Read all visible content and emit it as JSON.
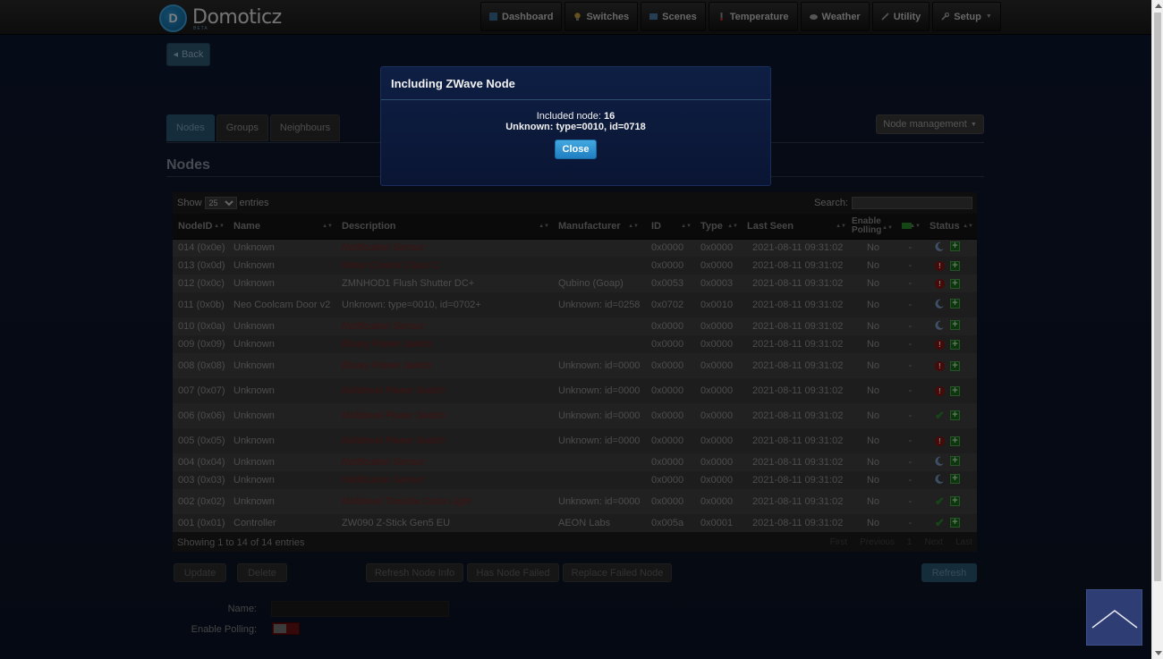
{
  "brand": {
    "name": "Domoticz",
    "sub": "BETA",
    "logo_letter": "D"
  },
  "nav": [
    {
      "label": "Dashboard",
      "icon": "dashboard-icon"
    },
    {
      "label": "Switches",
      "icon": "bulb-icon"
    },
    {
      "label": "Scenes",
      "icon": "scenes-icon"
    },
    {
      "label": "Temperature",
      "icon": "thermometer-icon"
    },
    {
      "label": "Weather",
      "icon": "cloud-icon"
    },
    {
      "label": "Utility",
      "icon": "utility-icon"
    },
    {
      "label": "Setup",
      "icon": "wrench-icon"
    }
  ],
  "back_label": "Back",
  "tabs": [
    {
      "label": "Nodes",
      "active": true
    },
    {
      "label": "Groups",
      "active": false
    },
    {
      "label": "Neighbours",
      "active": false
    }
  ],
  "node_management": "Node management",
  "section_title": "Nodes",
  "table": {
    "show_prefix": "Show",
    "show_value": "25",
    "show_suffix": "entries",
    "search_label": "Search:",
    "columns": [
      "NodeID",
      "Name",
      "Description",
      "Manufacturer",
      "ID",
      "Type",
      "Last Seen",
      "Enable Polling",
      "",
      "Status"
    ],
    "rows": [
      {
        "nodeid": "014 (0x0e)",
        "name": "Unknown",
        "desc": "Notification Sensor",
        "desc_red": true,
        "mfr": "",
        "id": "0x0000",
        "type": "0x0000",
        "seen": "2021-08-11 09:31:02",
        "poll": "No",
        "dash": "-",
        "status": "sleep"
      },
      {
        "nodeid": "013 (0x0d)",
        "name": "Unknown",
        "desc": "Motor Control Class C",
        "desc_red": true,
        "mfr": "",
        "id": "0x0000",
        "type": "0x0000",
        "seen": "2021-08-11 09:31:02",
        "poll": "No",
        "dash": "-",
        "status": "dead"
      },
      {
        "nodeid": "012 (0x0c)",
        "name": "Unknown",
        "desc": "ZMNHOD1 Flush Shutter DC+",
        "desc_red": false,
        "mfr": "Qubino (Goap)",
        "id": "0x0053",
        "type": "0x0003",
        "seen": "2021-08-11 09:31:02",
        "poll": "No",
        "dash": "-",
        "status": "dead"
      },
      {
        "nodeid": "011 (0x0b)",
        "name": "Neo Coolcam Door v2",
        "desc": "Unknown: type=0010, id=0702+",
        "desc_red": false,
        "mfr": "Unknown: id=0258",
        "id": "0x0702",
        "type": "0x0010",
        "seen": "2021-08-11 09:31:02",
        "poll": "No",
        "dash": "-",
        "status": "sleep"
      },
      {
        "nodeid": "010 (0x0a)",
        "name": "Unknown",
        "desc": "Notification Sensor",
        "desc_red": true,
        "mfr": "",
        "id": "0x0000",
        "type": "0x0000",
        "seen": "2021-08-11 09:31:02",
        "poll": "No",
        "dash": "-",
        "status": "sleep"
      },
      {
        "nodeid": "009 (0x09)",
        "name": "Unknown",
        "desc": "Binary Power Switch",
        "desc_red": true,
        "mfr": "",
        "id": "0x0000",
        "type": "0x0000",
        "seen": "2021-08-11 09:31:02",
        "poll": "No",
        "dash": "-",
        "status": "dead"
      },
      {
        "nodeid": "008 (0x08)",
        "name": "Unknown",
        "desc": "Binary Power Switch",
        "desc_red": true,
        "mfr": "Unknown: id=0000",
        "id": "0x0000",
        "type": "0x0000",
        "seen": "2021-08-11 09:31:02",
        "poll": "No",
        "dash": "-",
        "status": "dead"
      },
      {
        "nodeid": "007 (0x07)",
        "name": "Unknown",
        "desc": "Multilevel Power Switch",
        "desc_red": true,
        "mfr": "Unknown: id=0000",
        "id": "0x0000",
        "type": "0x0000",
        "seen": "2021-08-11 09:31:02",
        "poll": "No",
        "dash": "-",
        "status": "dead"
      },
      {
        "nodeid": "006 (0x06)",
        "name": "Unknown",
        "desc": "Multilevel Power Switch",
        "desc_red": true,
        "mfr": "Unknown: id=0000",
        "id": "0x0000",
        "type": "0x0000",
        "seen": "2021-08-11 09:31:02",
        "poll": "No",
        "dash": "-",
        "status": "ok"
      },
      {
        "nodeid": "005 (0x05)",
        "name": "Unknown",
        "desc": "Multilevel Power Switch",
        "desc_red": true,
        "mfr": "Unknown: id=0000",
        "id": "0x0000",
        "type": "0x0000",
        "seen": "2021-08-11 09:31:02",
        "poll": "No",
        "dash": "-",
        "status": "dead"
      },
      {
        "nodeid": "004 (0x04)",
        "name": "Unknown",
        "desc": "Notification Sensor",
        "desc_red": true,
        "mfr": "",
        "id": "0x0000",
        "type": "0x0000",
        "seen": "2021-08-11 09:31:02",
        "poll": "No",
        "dash": "-",
        "status": "sleep"
      },
      {
        "nodeid": "003 (0x03)",
        "name": "Unknown",
        "desc": "Notification Sensor",
        "desc_red": true,
        "mfr": "",
        "id": "0x0000",
        "type": "0x0000",
        "seen": "2021-08-11 09:31:02",
        "poll": "No",
        "dash": "-",
        "status": "sleep"
      },
      {
        "nodeid": "002 (0x02)",
        "name": "Unknown",
        "desc": "Multilevel Tunable Color Light",
        "desc_red": true,
        "mfr": "Unknown: id=0000",
        "id": "0x0000",
        "type": "0x0000",
        "seen": "2021-08-11 09:31:02",
        "poll": "No",
        "dash": "-",
        "status": "ok"
      },
      {
        "nodeid": "001 (0x01)",
        "name": "Controller",
        "desc": "ZW090 Z-Stick Gen5 EU",
        "desc_red": false,
        "mfr": "AEON Labs",
        "id": "0x005a",
        "type": "0x0001",
        "seen": "2021-08-11 09:31:02",
        "poll": "No",
        "dash": "-",
        "status": "ok"
      }
    ],
    "info": "Showing 1 to 14 of 14 entries",
    "pager": [
      "First",
      "Previous",
      "1",
      "Next",
      "Last"
    ]
  },
  "actions": {
    "update": "Update",
    "delete": "Delete",
    "refresh_node_info": "Refresh Node Info",
    "has_node_failed": "Has Node Failed",
    "replace_failed_node": "Replace Failed Node",
    "refresh": "Refresh"
  },
  "form": {
    "name_label": "Name:",
    "polling_label": "Enable Polling:"
  },
  "modal": {
    "title": "Including ZWave Node",
    "included_label": "Included node:",
    "included_value": "16",
    "unknown_line": "Unknown: type=0010, id=0718",
    "close_label": "Close"
  },
  "colors": {
    "accent": "#2b5b76",
    "modal_bg": "#0e1f44",
    "status_dead": "#8a1414",
    "status_ok": "#2a8c2a"
  }
}
